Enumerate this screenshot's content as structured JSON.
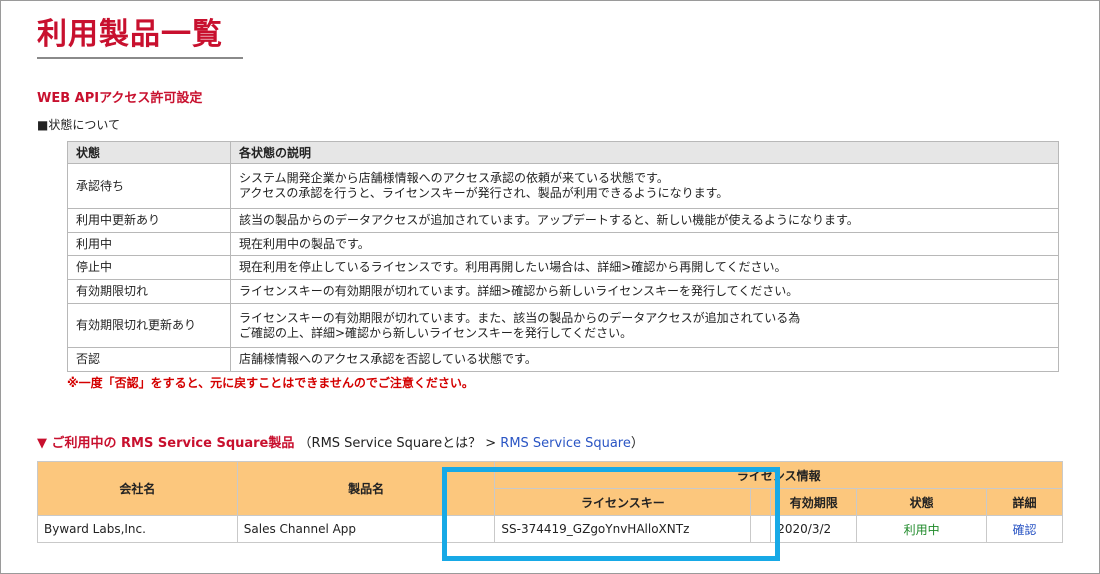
{
  "page": {
    "title": "利用製品一覧",
    "section_heading": "WEB APIアクセス許可設定",
    "status_note": "■状態について"
  },
  "status_table": {
    "headers": [
      "状態",
      "各状態の説明"
    ],
    "rows": [
      {
        "status": "承認待ち",
        "desc1": "システム開発企業から店舗様情報へのアクセス承認の依頼が来ている状態です。",
        "desc2": "アクセスの承認を行うと、ライセンスキーが発行され、製品が利用できるようになります。"
      },
      {
        "status": "利用中更新あり",
        "desc1": "該当の製品からのデータアクセスが追加されています。アップデートすると、新しい機能が使えるようになります。",
        "desc2": ""
      },
      {
        "status": "利用中",
        "desc1": "現在利用中の製品です。",
        "desc2": ""
      },
      {
        "status": "停止中",
        "desc1": "現在利用を停止しているライセンスです。利用再開したい場合は、詳細>確認から再開してください。",
        "desc2": ""
      },
      {
        "status": "有効期限切れ",
        "desc1": "ライセンスキーの有効期限が切れています。詳細>確認から新しいライセンスキーを発行してください。",
        "desc2": ""
      },
      {
        "status": "有効期限切れ更新あり",
        "desc1": "ライセンスキーの有効期限が切れています。また、該当の製品からのデータアクセスが追加されている為",
        "desc2": "ご確認の上、詳細>確認から新しいライセンスキーを発行してください。"
      },
      {
        "status": "否認",
        "desc1": "店舗様情報へのアクセス承認を否認している状態です。",
        "desc2": ""
      }
    ]
  },
  "warning": "※一度「否認」をすると、元に戻すことはできませんのでご注意ください。",
  "products": {
    "heading_marker": "▼ ご利用中の RMS Service Square製品",
    "heading_middle": "（RMS Service Squareとは？ > ",
    "heading_link": "RMS Service Square",
    "heading_end": "）",
    "headers": {
      "company": "会社名",
      "product": "製品名",
      "license_info": "ライセンス情報",
      "license_key": "ライセンスキー",
      "expiry": "有効期限",
      "status": "状態",
      "details": "詳細"
    },
    "rows": [
      {
        "company": "Byward Labs,Inc.",
        "product": "Sales Channel App",
        "license_key": "SS-374419_GZgoYnvHAlloXNTz",
        "expiry": "2020/3/2",
        "status": "利用中",
        "details": "確認"
      }
    ]
  },
  "colors": {
    "title_red": "#c8102e",
    "header_orange": "#fcc77d",
    "highlight_blue": "#17a9e6",
    "status_green": "#1f8a2a",
    "link_blue": "#2a55c4"
  }
}
